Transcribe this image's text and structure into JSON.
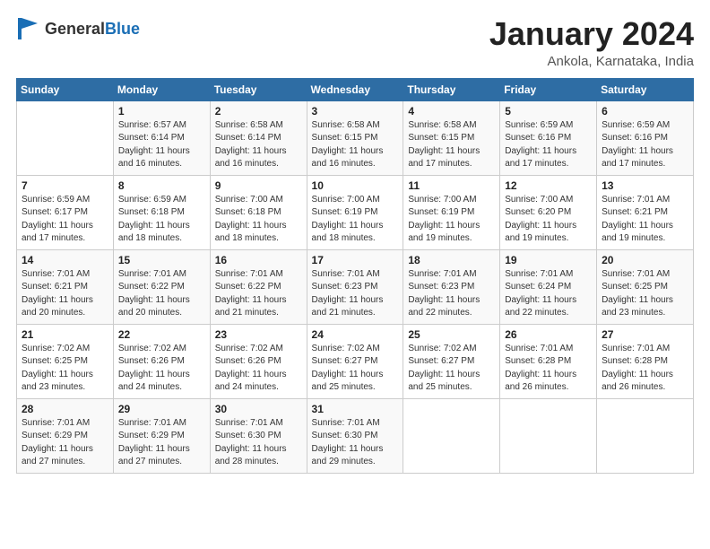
{
  "logo": {
    "general": "General",
    "blue": "Blue"
  },
  "header": {
    "month_year": "January 2024",
    "location": "Ankola, Karnataka, India"
  },
  "weekdays": [
    "Sunday",
    "Monday",
    "Tuesday",
    "Wednesday",
    "Thursday",
    "Friday",
    "Saturday"
  ],
  "weeks": [
    [
      {
        "day": "",
        "info": ""
      },
      {
        "day": "1",
        "info": "Sunrise: 6:57 AM\nSunset: 6:14 PM\nDaylight: 11 hours\nand 16 minutes."
      },
      {
        "day": "2",
        "info": "Sunrise: 6:58 AM\nSunset: 6:14 PM\nDaylight: 11 hours\nand 16 minutes."
      },
      {
        "day": "3",
        "info": "Sunrise: 6:58 AM\nSunset: 6:15 PM\nDaylight: 11 hours\nand 16 minutes."
      },
      {
        "day": "4",
        "info": "Sunrise: 6:58 AM\nSunset: 6:15 PM\nDaylight: 11 hours\nand 17 minutes."
      },
      {
        "day": "5",
        "info": "Sunrise: 6:59 AM\nSunset: 6:16 PM\nDaylight: 11 hours\nand 17 minutes."
      },
      {
        "day": "6",
        "info": "Sunrise: 6:59 AM\nSunset: 6:16 PM\nDaylight: 11 hours\nand 17 minutes."
      }
    ],
    [
      {
        "day": "7",
        "info": "Sunrise: 6:59 AM\nSunset: 6:17 PM\nDaylight: 11 hours\nand 17 minutes."
      },
      {
        "day": "8",
        "info": "Sunrise: 6:59 AM\nSunset: 6:18 PM\nDaylight: 11 hours\nand 18 minutes."
      },
      {
        "day": "9",
        "info": "Sunrise: 7:00 AM\nSunset: 6:18 PM\nDaylight: 11 hours\nand 18 minutes."
      },
      {
        "day": "10",
        "info": "Sunrise: 7:00 AM\nSunset: 6:19 PM\nDaylight: 11 hours\nand 18 minutes."
      },
      {
        "day": "11",
        "info": "Sunrise: 7:00 AM\nSunset: 6:19 PM\nDaylight: 11 hours\nand 19 minutes."
      },
      {
        "day": "12",
        "info": "Sunrise: 7:00 AM\nSunset: 6:20 PM\nDaylight: 11 hours\nand 19 minutes."
      },
      {
        "day": "13",
        "info": "Sunrise: 7:01 AM\nSunset: 6:21 PM\nDaylight: 11 hours\nand 19 minutes."
      }
    ],
    [
      {
        "day": "14",
        "info": "Sunrise: 7:01 AM\nSunset: 6:21 PM\nDaylight: 11 hours\nand 20 minutes."
      },
      {
        "day": "15",
        "info": "Sunrise: 7:01 AM\nSunset: 6:22 PM\nDaylight: 11 hours\nand 20 minutes."
      },
      {
        "day": "16",
        "info": "Sunrise: 7:01 AM\nSunset: 6:22 PM\nDaylight: 11 hours\nand 21 minutes."
      },
      {
        "day": "17",
        "info": "Sunrise: 7:01 AM\nSunset: 6:23 PM\nDaylight: 11 hours\nand 21 minutes."
      },
      {
        "day": "18",
        "info": "Sunrise: 7:01 AM\nSunset: 6:23 PM\nDaylight: 11 hours\nand 22 minutes."
      },
      {
        "day": "19",
        "info": "Sunrise: 7:01 AM\nSunset: 6:24 PM\nDaylight: 11 hours\nand 22 minutes."
      },
      {
        "day": "20",
        "info": "Sunrise: 7:01 AM\nSunset: 6:25 PM\nDaylight: 11 hours\nand 23 minutes."
      }
    ],
    [
      {
        "day": "21",
        "info": "Sunrise: 7:02 AM\nSunset: 6:25 PM\nDaylight: 11 hours\nand 23 minutes."
      },
      {
        "day": "22",
        "info": "Sunrise: 7:02 AM\nSunset: 6:26 PM\nDaylight: 11 hours\nand 24 minutes."
      },
      {
        "day": "23",
        "info": "Sunrise: 7:02 AM\nSunset: 6:26 PM\nDaylight: 11 hours\nand 24 minutes."
      },
      {
        "day": "24",
        "info": "Sunrise: 7:02 AM\nSunset: 6:27 PM\nDaylight: 11 hours\nand 25 minutes."
      },
      {
        "day": "25",
        "info": "Sunrise: 7:02 AM\nSunset: 6:27 PM\nDaylight: 11 hours\nand 25 minutes."
      },
      {
        "day": "26",
        "info": "Sunrise: 7:01 AM\nSunset: 6:28 PM\nDaylight: 11 hours\nand 26 minutes."
      },
      {
        "day": "27",
        "info": "Sunrise: 7:01 AM\nSunset: 6:28 PM\nDaylight: 11 hours\nand 26 minutes."
      }
    ],
    [
      {
        "day": "28",
        "info": "Sunrise: 7:01 AM\nSunset: 6:29 PM\nDaylight: 11 hours\nand 27 minutes."
      },
      {
        "day": "29",
        "info": "Sunrise: 7:01 AM\nSunset: 6:29 PM\nDaylight: 11 hours\nand 27 minutes."
      },
      {
        "day": "30",
        "info": "Sunrise: 7:01 AM\nSunset: 6:30 PM\nDaylight: 11 hours\nand 28 minutes."
      },
      {
        "day": "31",
        "info": "Sunrise: 7:01 AM\nSunset: 6:30 PM\nDaylight: 11 hours\nand 29 minutes."
      },
      {
        "day": "",
        "info": ""
      },
      {
        "day": "",
        "info": ""
      },
      {
        "day": "",
        "info": ""
      }
    ]
  ]
}
